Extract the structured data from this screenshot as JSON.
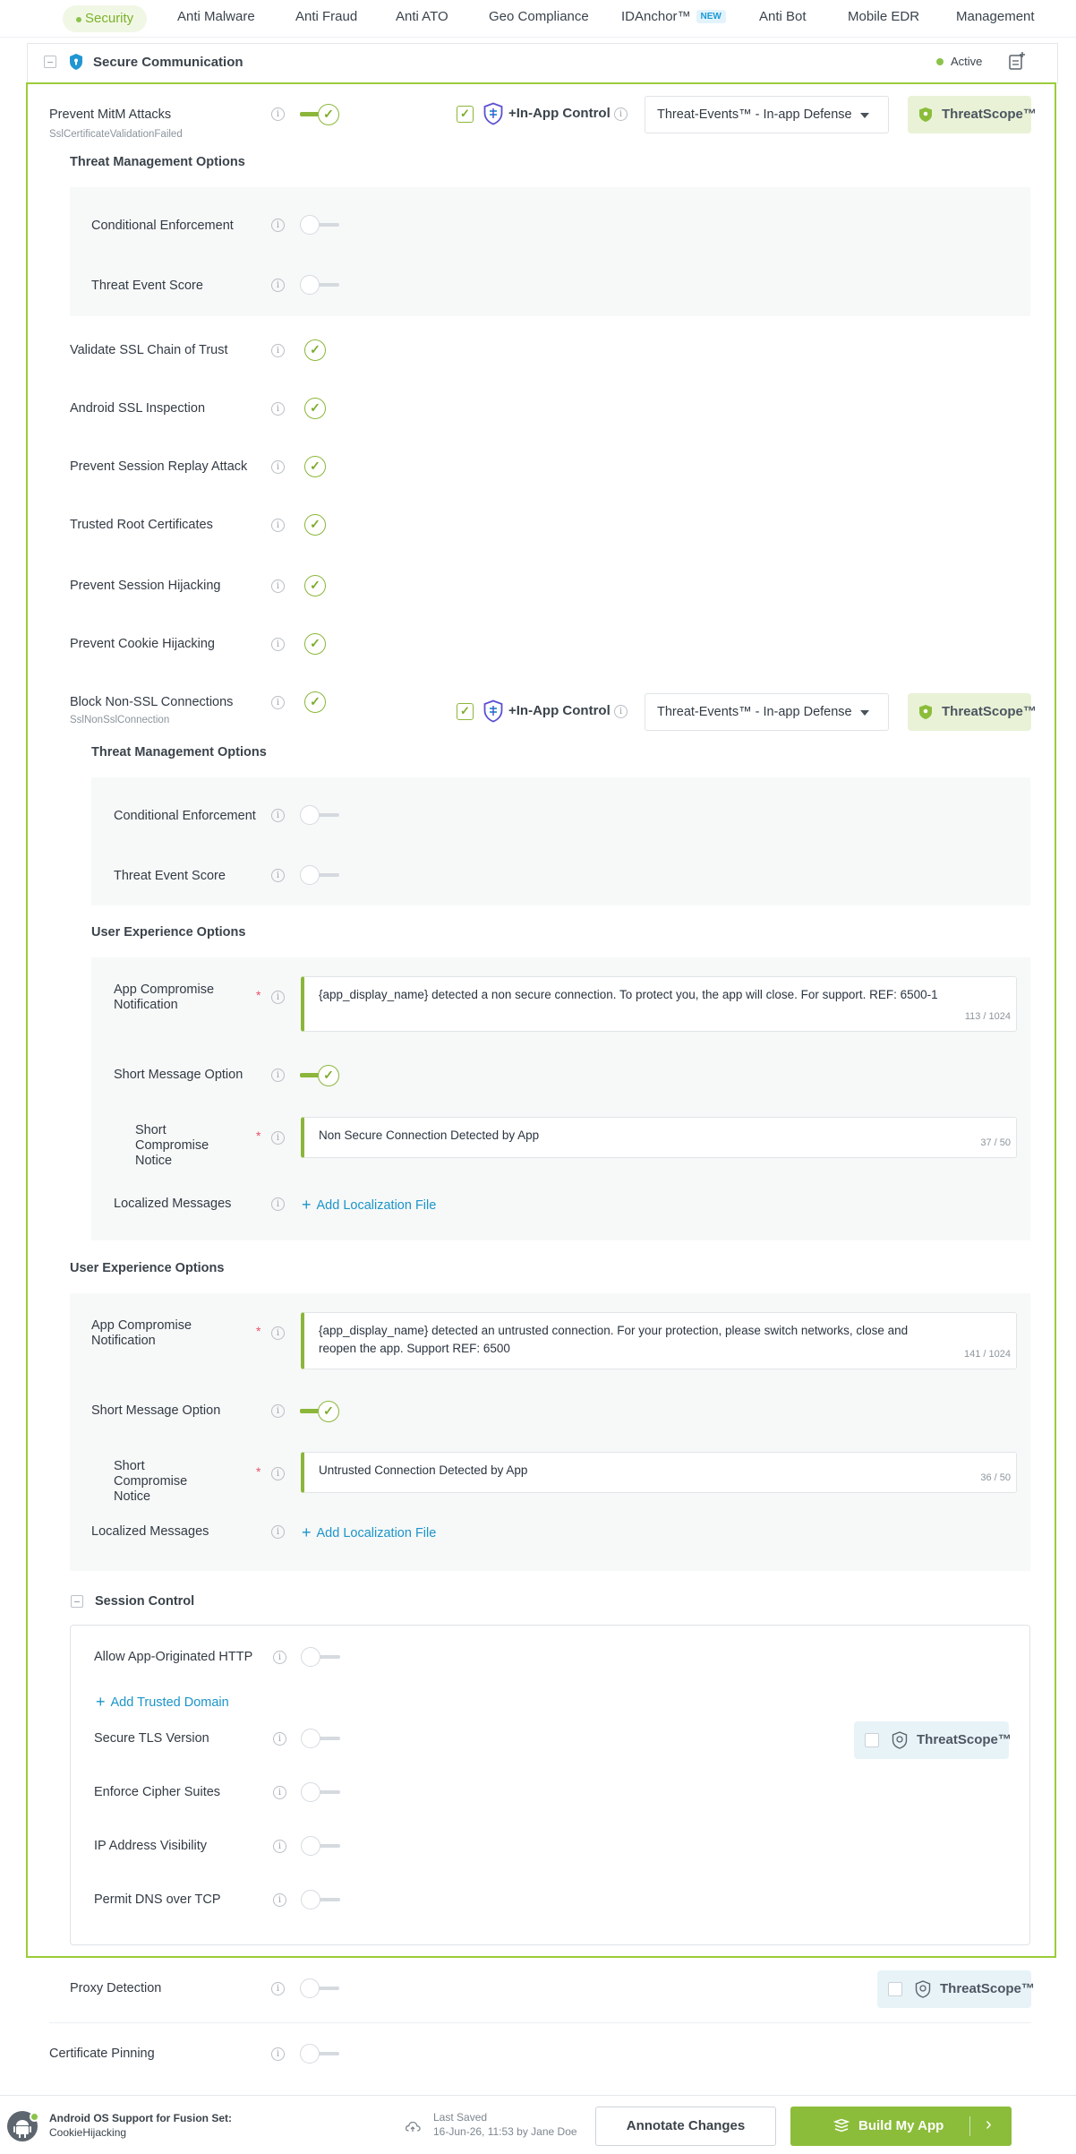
{
  "nav": {
    "tabs": [
      "Security",
      "Anti Malware",
      "Anti Fraud",
      "Anti ATO",
      "Geo Compliance",
      "IDAnchor™",
      "Anti Bot",
      "Mobile EDR",
      "Management"
    ],
    "new_badge": "NEW"
  },
  "section": {
    "title": "Secure Communication",
    "status": "Active"
  },
  "mitm": {
    "label": "Prevent MitM Attacks",
    "sub": "SslCertificateValidationFailed",
    "inapp": "+In-App Control",
    "dropdown": "Threat-Events™ - In-app Defense",
    "threatscope": "ThreatScope™",
    "tmo_heading": "Threat Management Options",
    "conditional": "Conditional Enforcement",
    "score": "Threat Event Score",
    "uxo_heading": "User Experience Options",
    "notif_label": "App Compromise Notification",
    "notif_text": "{app_display_name} detected an untrusted connection. For your protection, please switch networks, close and reopen the app. Support REF: 6500",
    "notif_count": "141 / 1024",
    "short_option": "Short Message Option",
    "short_label": "Short Compromise Notice",
    "short_text": "Untrusted Connection Detected by App",
    "short_count": "36 / 50",
    "localized": "Localized Messages",
    "add_localization": "Add Localization File"
  },
  "checks": [
    "Validate SSL Chain of Trust",
    "Android SSL Inspection",
    "Prevent Session Replay Attack",
    "Trusted Root Certificates",
    "Prevent Session Hijacking",
    "Prevent Cookie Hijacking"
  ],
  "nonssl": {
    "label": "Block Non-SSL Connections",
    "sub": "SslNonSslConnection",
    "inapp": "+In-App Control",
    "dropdown": "Threat-Events™ - In-app Defense",
    "threatscope": "ThreatScope™",
    "tmo_heading": "Threat Management Options",
    "conditional": "Conditional Enforcement",
    "score": "Threat Event Score",
    "uxo_heading": "User Experience Options",
    "notif_label": "App Compromise Notification",
    "notif_text": "{app_display_name} detected a non secure connection. To protect you, the app will close. For support. REF: 6500-1",
    "notif_count": "113 / 1024",
    "short_option": "Short Message Option",
    "short_label": "Short Compromise Notice",
    "short_text": "Non Secure Connection Detected by App",
    "short_count": "37 / 50",
    "localized": "Localized Messages",
    "add_localization": "Add Localization File"
  },
  "session": {
    "title": "Session Control",
    "allow_http": "Allow App-Originated HTTP",
    "add_domain": "Add Trusted Domain",
    "tls": "Secure TLS Version",
    "threatscope": "ThreatScope™",
    "cipher": "Enforce Cipher Suites",
    "ip": "IP Address Visibility",
    "dns": "Permit DNS over TCP"
  },
  "proxy": {
    "label": "Proxy Detection",
    "threatscope": "ThreatScope™"
  },
  "pinning": {
    "label": "Certificate Pinning"
  },
  "footer": {
    "os_line1": "Android OS Support for Fusion Set:",
    "os_line2": "CookieHijacking",
    "saved_label": "Last Saved",
    "saved_value": "16-Jun-26, 11:53 by Jane Doe",
    "annotate": "Annotate Changes",
    "build": "Build My App"
  },
  "colors": {
    "accent": "#8bb63a",
    "link": "#1b95c9",
    "frame": "#9ccc3a"
  }
}
